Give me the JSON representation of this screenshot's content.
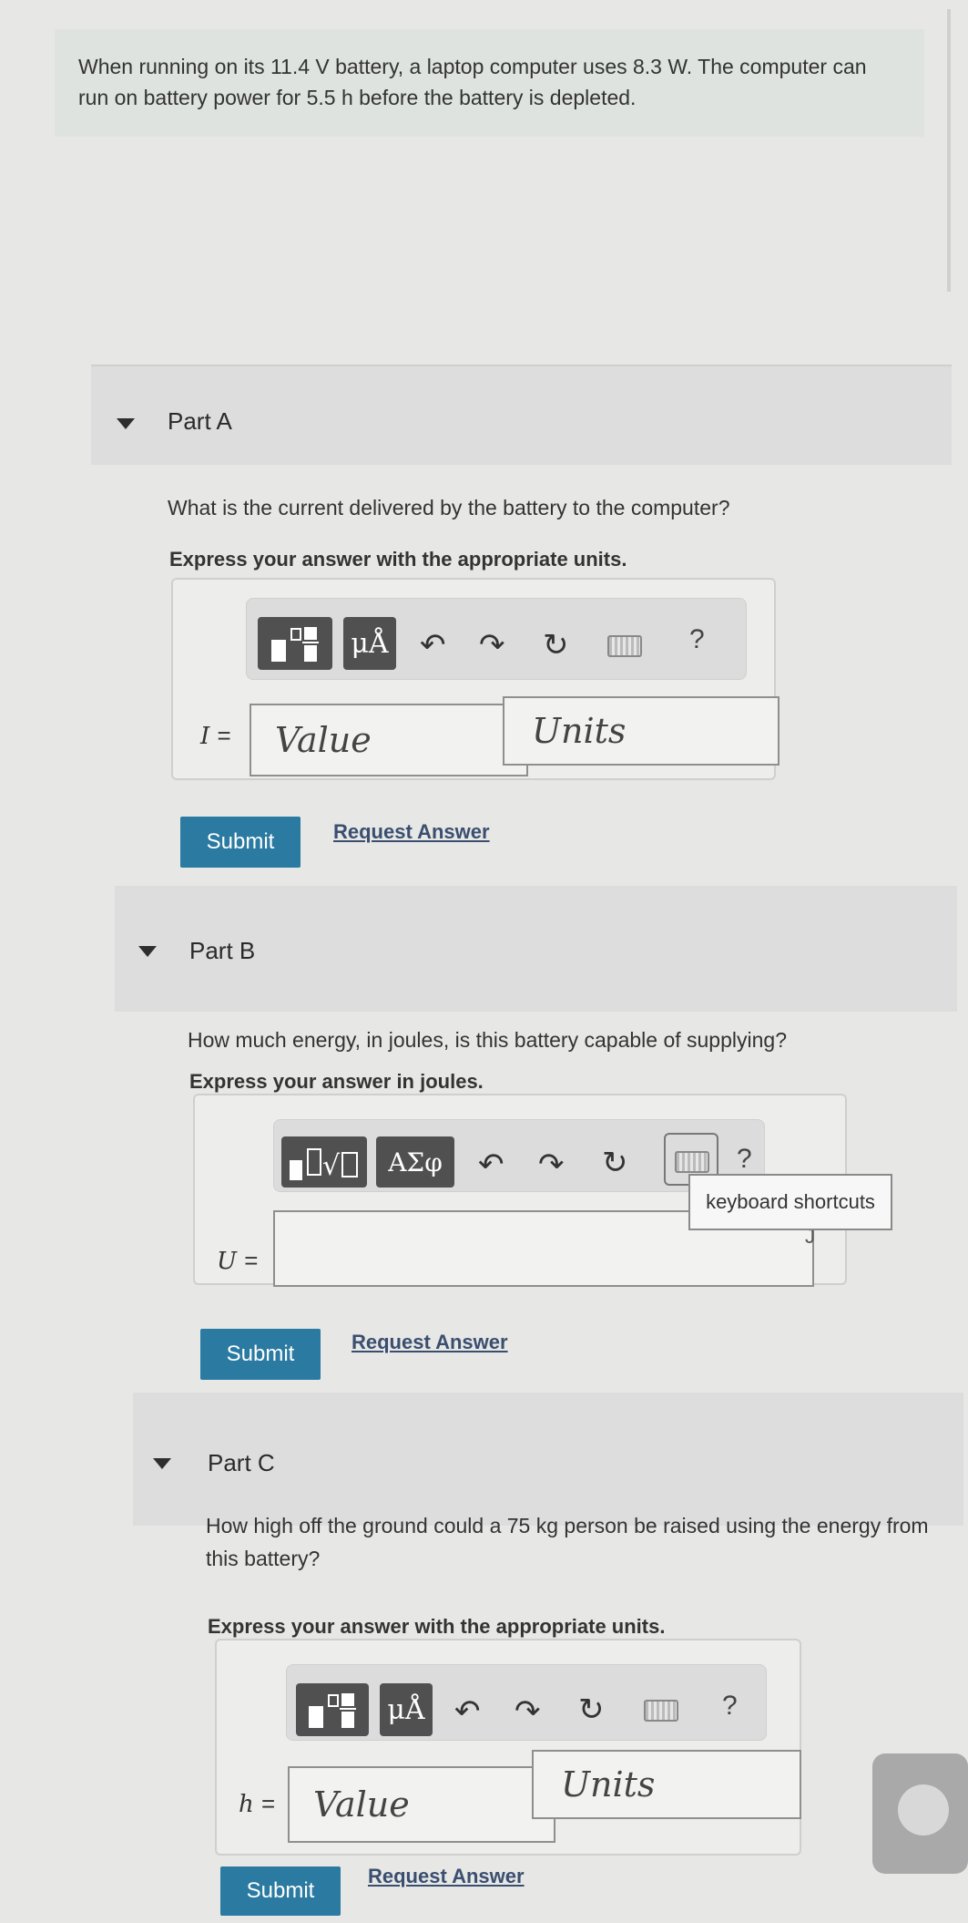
{
  "problem": {
    "text": "When running on its 11.4 V battery, a laptop computer uses 8.3 W. The computer can run on battery power for 5.5 h before the battery is depleted."
  },
  "toolbar": {
    "units_symbol": "μÅ",
    "greek_symbol": "ΑΣφ",
    "help_label": "?",
    "icons": [
      "templates-icon",
      "units-icon",
      "greek-icon",
      "undo-icon",
      "redo-icon",
      "reset-icon",
      "keyboard-icon",
      "help-icon"
    ]
  },
  "parts": [
    {
      "label": "Part A",
      "question": "What is the current delivered by the battery to the computer?",
      "instruction": "Express your answer with the appropriate units.",
      "variable": "I",
      "value_placeholder": "Value",
      "units_placeholder": "Units",
      "submit_label": "Submit",
      "request_label": "Request Answer"
    },
    {
      "label": "Part B",
      "question": "How much energy, in joules, is this battery capable of supplying?",
      "instruction": "Express your answer in joules.",
      "variable": "U",
      "unit_suffix": "J",
      "tooltip": "keyboard shortcuts",
      "submit_label": "Submit",
      "request_label": "Request Answer"
    },
    {
      "label": "Part C",
      "question_line1": "How high off the ground could a 75 kg person be raised using the energy from",
      "question_line2": "this battery?",
      "instruction": "Express your answer with the appropriate units.",
      "variable": "h",
      "value_placeholder": "Value",
      "units_placeholder": "Units",
      "submit_label": "Submit",
      "request_label": "Request Answer"
    }
  ],
  "colors": {
    "submit": "#2a7aa1",
    "link": "#3a4e70",
    "problem_bg": "#dee3df",
    "part_header_bg": "#dddddd"
  }
}
